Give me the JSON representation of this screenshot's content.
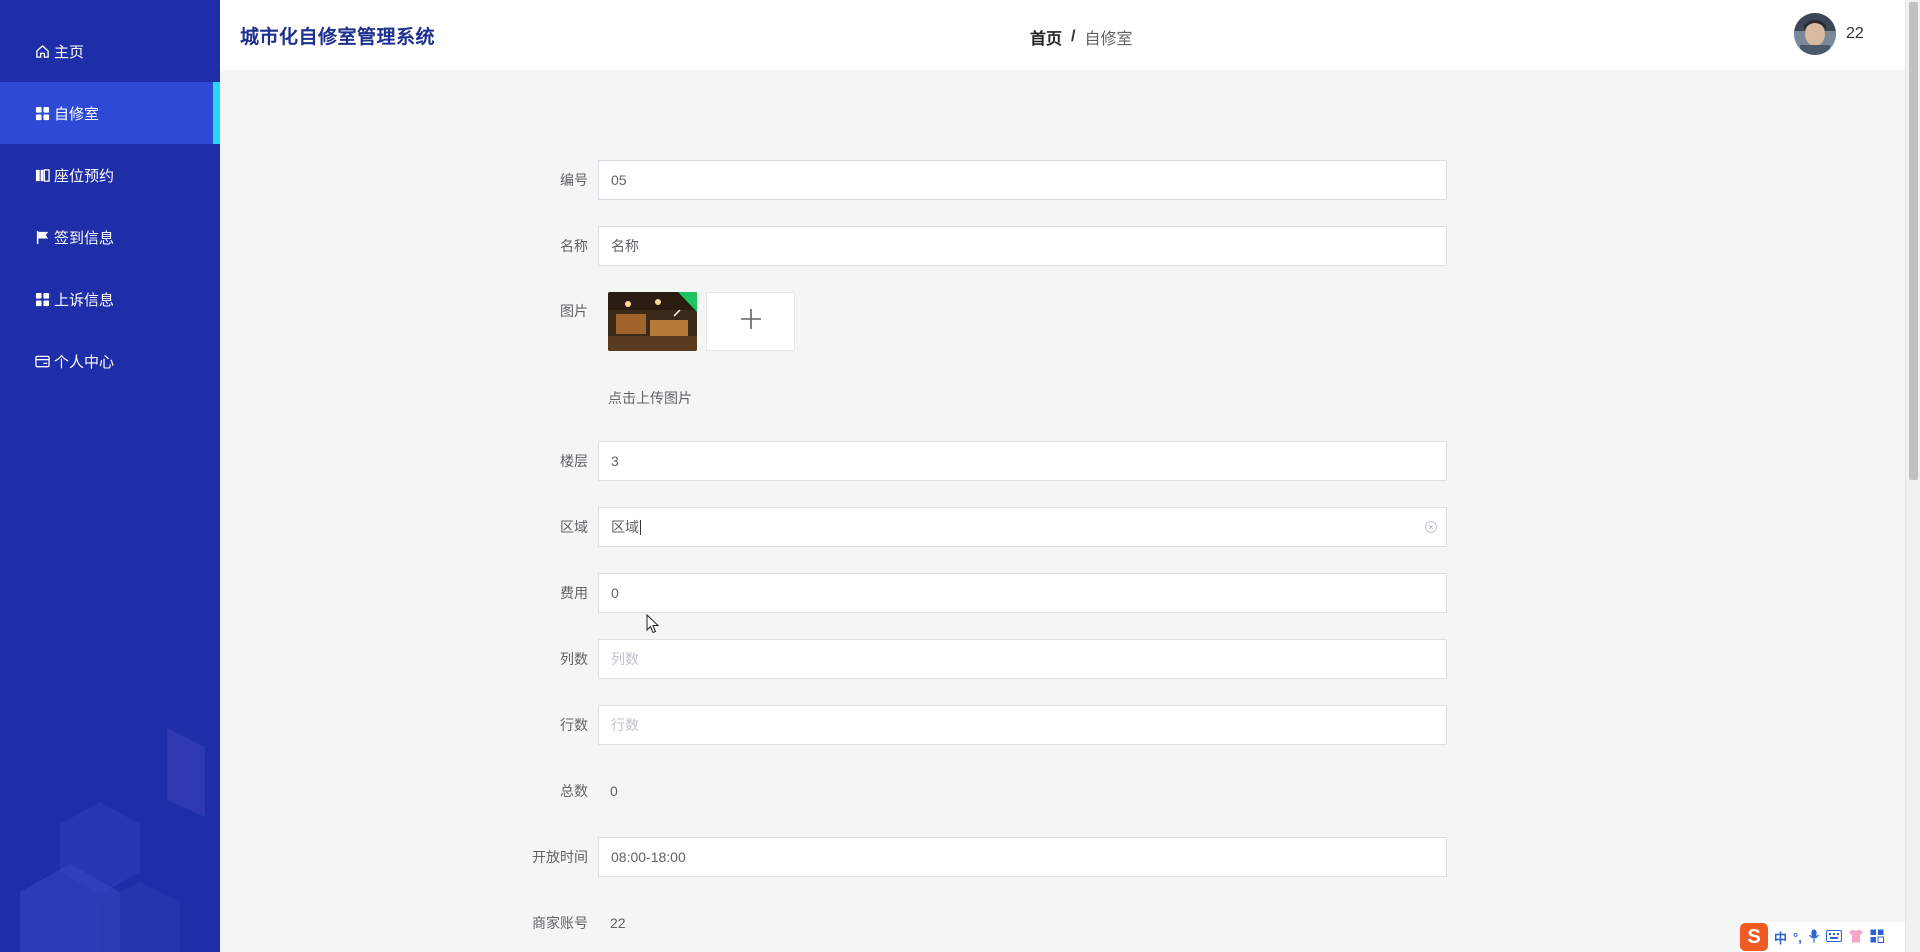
{
  "app": {
    "title": "城市化自修室管理系统"
  },
  "sidebar": {
    "items": [
      {
        "label": "主页",
        "icon": "home-icon",
        "active": false
      },
      {
        "label": "自修室",
        "icon": "grid-icon",
        "active": true
      },
      {
        "label": "座位预约",
        "icon": "book-icon",
        "active": false
      },
      {
        "label": "签到信息",
        "icon": "flag-icon",
        "active": false
      },
      {
        "label": "上诉信息",
        "icon": "grid-icon",
        "active": false
      },
      {
        "label": "个人中心",
        "icon": "card-icon",
        "active": false
      }
    ]
  },
  "header": {
    "breadcrumb": {
      "home": "首页",
      "separator": "/",
      "current": "自修室"
    },
    "user": {
      "name": "22"
    }
  },
  "form": {
    "code": {
      "label": "编号",
      "value": "05"
    },
    "name": {
      "label": "名称",
      "value": "名称"
    },
    "image": {
      "label": "图片",
      "hint": "点击上传图片"
    },
    "floor": {
      "label": "楼层",
      "value": "3"
    },
    "area": {
      "label": "区域",
      "value": "区域"
    },
    "fee": {
      "label": "费用",
      "value": "0"
    },
    "columns": {
      "label": "列数",
      "placeholder": "列数"
    },
    "rows": {
      "label": "行数",
      "placeholder": "行数"
    },
    "total": {
      "label": "总数",
      "value": "0"
    },
    "open_time": {
      "label": "开放时间",
      "value": "08:00-18:00"
    },
    "merchant_account": {
      "label": "商家账号",
      "value": "22"
    }
  },
  "ime": {
    "logo": "S",
    "mode": "中"
  },
  "colors": {
    "sidebar_bg": "#1e2ea8",
    "sidebar_active": "#2e49d6",
    "active_indicator": "#27d8f5",
    "brand_text": "#1d2f8f"
  }
}
